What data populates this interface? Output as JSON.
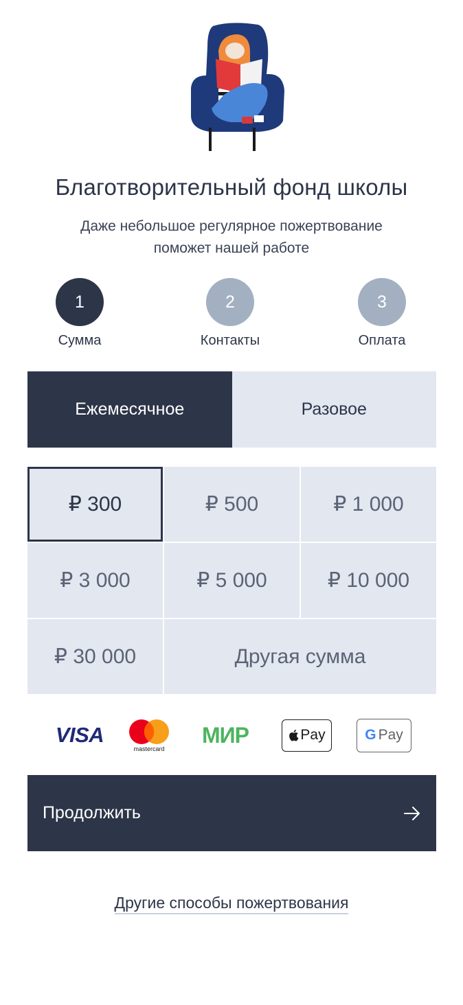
{
  "header": {
    "title": "Благотворительный фонд школы",
    "subtitle": "Даже небольшое регулярное пожертвование поможет нашей работе"
  },
  "steps": [
    {
      "number": "1",
      "label": "Сумма",
      "active": true
    },
    {
      "number": "2",
      "label": "Контакты",
      "active": false
    },
    {
      "number": "3",
      "label": "Оплата",
      "active": false
    }
  ],
  "frequency": {
    "monthly_label": "Ежемесячное",
    "once_label": "Разовое",
    "selected": "monthly"
  },
  "amounts": {
    "items": [
      "₽ 300",
      "₽ 500",
      "₽ 1 000",
      "₽ 3 000",
      "₽ 5 000",
      "₽ 10 000",
      "₽ 30 000"
    ],
    "other_label": "Другая сумма",
    "selected": "₽ 300"
  },
  "payment_methods": {
    "visa": "VISA",
    "mastercard": "mastercard",
    "mir": "МИР",
    "apple_pay": "Pay",
    "google_pay": "Pay"
  },
  "actions": {
    "continue_label": "Продолжить",
    "other_ways_label": "Другие способы пожертвования"
  },
  "colors": {
    "primary": "#2d3548",
    "inactive_step": "#a3b0c1",
    "tile_bg": "#e2e7f0",
    "mir_green": "#4db45e"
  }
}
